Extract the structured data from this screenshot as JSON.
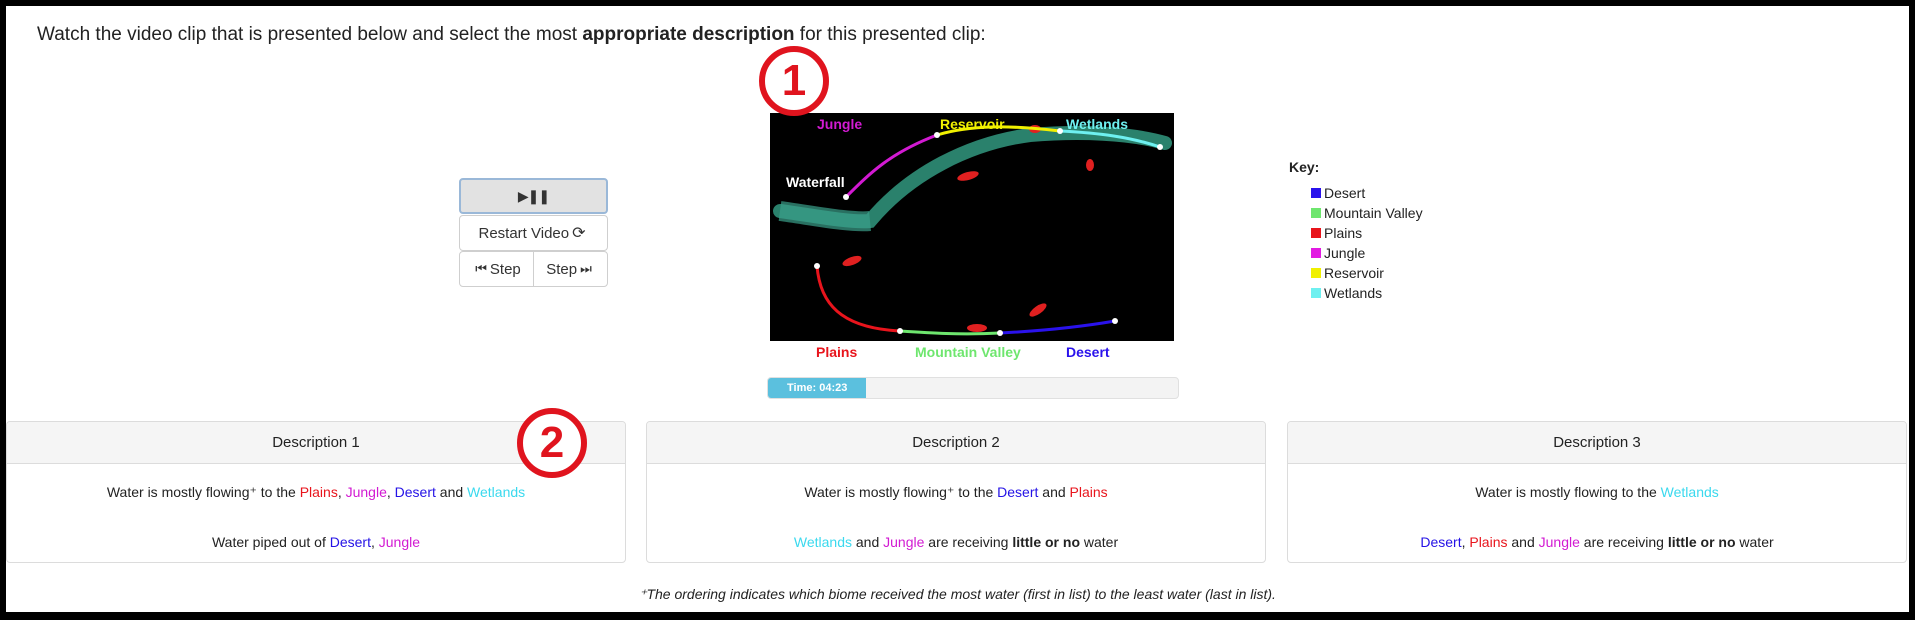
{
  "instruction": {
    "prefix": "Watch the video clip that is presented below and select the most ",
    "bold": "appropriate description",
    "suffix": " for this presented clip:"
  },
  "controls": {
    "play_pause_icon": "▶❚❚",
    "restart_label": "Restart Video",
    "restart_icon": "⟳",
    "step_back_label": "Step",
    "step_back_icon": "⏮",
    "step_fwd_label": "Step",
    "step_fwd_icon": "⏭"
  },
  "video": {
    "labels": {
      "jungle": "Jungle",
      "reservoir": "Reservoir",
      "wetlands": "Wetlands",
      "waterfall": "Waterfall",
      "plains": "Plains",
      "mountain_valley": "Mountain Valley",
      "desert": "Desert"
    }
  },
  "time": {
    "label": "Time: 04:23",
    "progress_fraction": 0.24
  },
  "callouts": {
    "one": "1",
    "two": "2"
  },
  "key": {
    "title": "Key:",
    "items": [
      {
        "label": "Desert",
        "color": "#2a12ec"
      },
      {
        "label": "Mountain Valley",
        "color": "#6ee66e"
      },
      {
        "label": "Plains",
        "color": "#e8141c"
      },
      {
        "label": "Jungle",
        "color": "#e21ae2"
      },
      {
        "label": "Reservoir",
        "color": "#f0f000"
      },
      {
        "label": "Wetlands",
        "color": "#6ef0f0"
      }
    ]
  },
  "descriptions": [
    {
      "title": "Description 1",
      "line1": {
        "pre": "Water is mostly flowing⁺ to the ",
        "a": "Plains",
        "s1": ", ",
        "b": "Jungle",
        "s2": ", ",
        "c": "Desert",
        "s3": " and ",
        "d": "Wetlands"
      },
      "line2": {
        "pre": "Water piped out of ",
        "a": "Desert",
        "s1": ", ",
        "b": "Jungle"
      }
    },
    {
      "title": "Description 2",
      "line1": {
        "pre": "Water is mostly flowing⁺ to the ",
        "a": "Desert",
        "s1": " and ",
        "b": "Plains"
      },
      "line2": {
        "a": "Wetlands",
        "s1": " and ",
        "b": "Jungle",
        "s2": " are receiving ",
        "bold": "little or no",
        "post": " water"
      }
    },
    {
      "title": "Description 3",
      "line1": {
        "pre": "Water is mostly flowing to the ",
        "a": "Wetlands"
      },
      "line2": {
        "a": "Desert",
        "s1": ", ",
        "b": "Plains",
        "s2": " and ",
        "c": "Jungle",
        "s3": " are receiving ",
        "bold": "little or no",
        "post": " water"
      }
    }
  ],
  "footnote": "⁺The ordering indicates which biome received the most water (first in list) to the least water (last in list)."
}
